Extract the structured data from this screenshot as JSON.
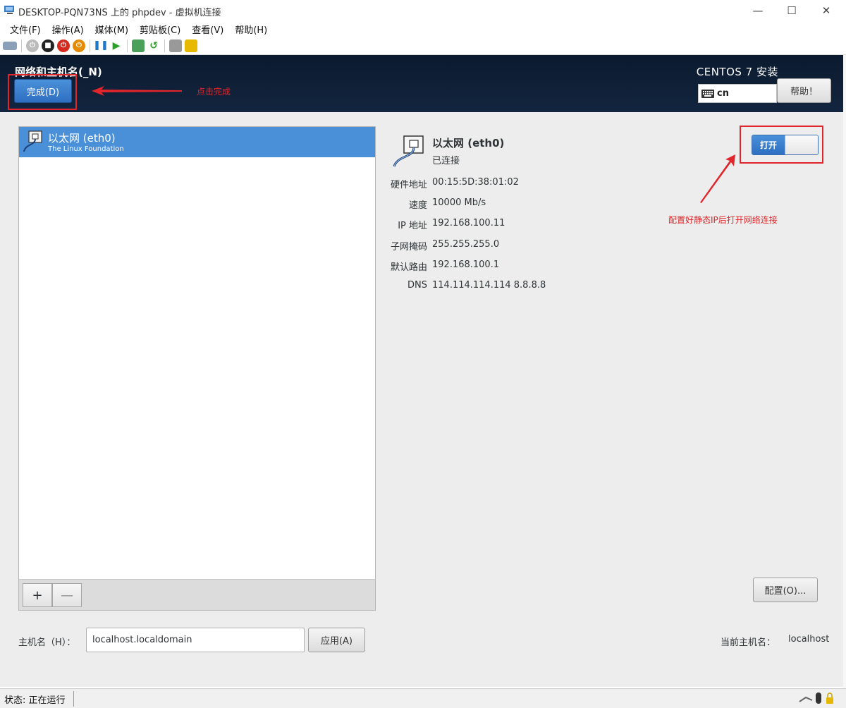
{
  "window": {
    "title": "DESKTOP-PQN73NS 上的 phpdev - 虚拟机连接",
    "minimize": "—",
    "maximize": "☐",
    "close": "✕"
  },
  "menu": [
    "文件(F)",
    "操作(A)",
    "媒体(M)",
    "剪贴板(C)",
    "查看(V)",
    "帮助(H)"
  ],
  "header": {
    "spoke_title": "网络和主机名(_N)",
    "done_label": "完成(D)",
    "product_title": "CENTOS 7 安装",
    "keyboard_layout": "cn",
    "help_label": "帮助！"
  },
  "annotations": {
    "click_done": "点击完成",
    "enable_network": "配置好静态IP后打开网络连接",
    "accent_red": "#e0262b"
  },
  "devices": [
    {
      "name": "以太网 (eth0)",
      "vendor": "The Linux Foundation"
    }
  ],
  "device_actions": {
    "add": "+",
    "remove": "—"
  },
  "details": {
    "name": "以太网 (eth0)",
    "status": "已连接",
    "switch_label": "打开",
    "props": [
      {
        "label": "硬件地址",
        "value": "00:15:5D:38:01:02"
      },
      {
        "label": "速度",
        "value": "10000 Mb/s"
      },
      {
        "label": "IP 地址",
        "value": "192.168.100.11"
      },
      {
        "label": "子网掩码",
        "value": "255.255.255.0"
      },
      {
        "label": "默认路由",
        "value": "192.168.100.1"
      },
      {
        "label": "DNS",
        "value": "114.114.114.114 8.8.8.8"
      }
    ],
    "config_label": "配置(O)..."
  },
  "hostname": {
    "label": "主机名（H）：",
    "value": "localhost.localdomain",
    "apply_label": "应用(A)",
    "current_label": "当前主机名：",
    "current_value": "localhost"
  },
  "statusbar": {
    "text": "状态: 正在运行"
  },
  "colors": {
    "accent_blue": "#4a90d9",
    "header_bg": "#0b1a2e"
  }
}
